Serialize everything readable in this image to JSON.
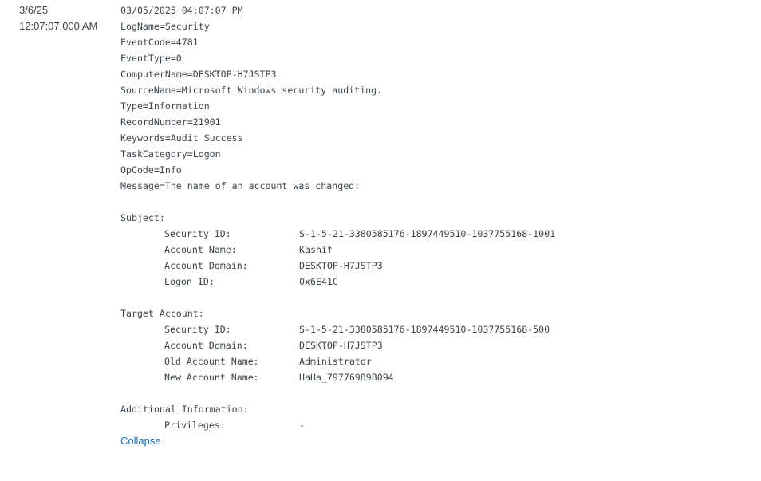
{
  "timestamp": {
    "date": "3/6/25",
    "time": "12:07:07.000 AM"
  },
  "event": {
    "header_time": "03/05/2025 04:07:07 PM",
    "lines": [
      "LogName=Security",
      "EventCode=4781",
      "EventType=0",
      "ComputerName=DESKTOP-H7JSTP3",
      "SourceName=Microsoft Windows security auditing.",
      "Type=Information",
      "RecordNumber=21901",
      "Keywords=Audit Success",
      "TaskCategory=Logon",
      "OpCode=Info",
      "Message=The name of an account was changed:"
    ],
    "subject": {
      "heading": "Subject:",
      "fields": [
        {
          "label": "Security ID:",
          "value": "S-1-5-21-3380585176-1897449510-1037755168-1001"
        },
        {
          "label": "Account Name:",
          "value": "Kashif"
        },
        {
          "label": "Account Domain:",
          "value": "DESKTOP-H7JSTP3"
        },
        {
          "label": "Logon ID:",
          "value": "0x6E41C"
        }
      ]
    },
    "target": {
      "heading": "Target Account:",
      "fields": [
        {
          "label": "Security ID:",
          "value": "S-1-5-21-3380585176-1897449510-1037755168-500"
        },
        {
          "label": "Account Domain:",
          "value": "DESKTOP-H7JSTP3"
        },
        {
          "label": "Old Account Name:",
          "value": "Administrator"
        },
        {
          "label": "New Account Name:",
          "value": "HaHa_797769898094"
        }
      ]
    },
    "additional": {
      "heading": "Additional Information:",
      "fields": [
        {
          "label": "Privileges:",
          "value": "-"
        }
      ]
    }
  },
  "collapse_label": "Collapse"
}
